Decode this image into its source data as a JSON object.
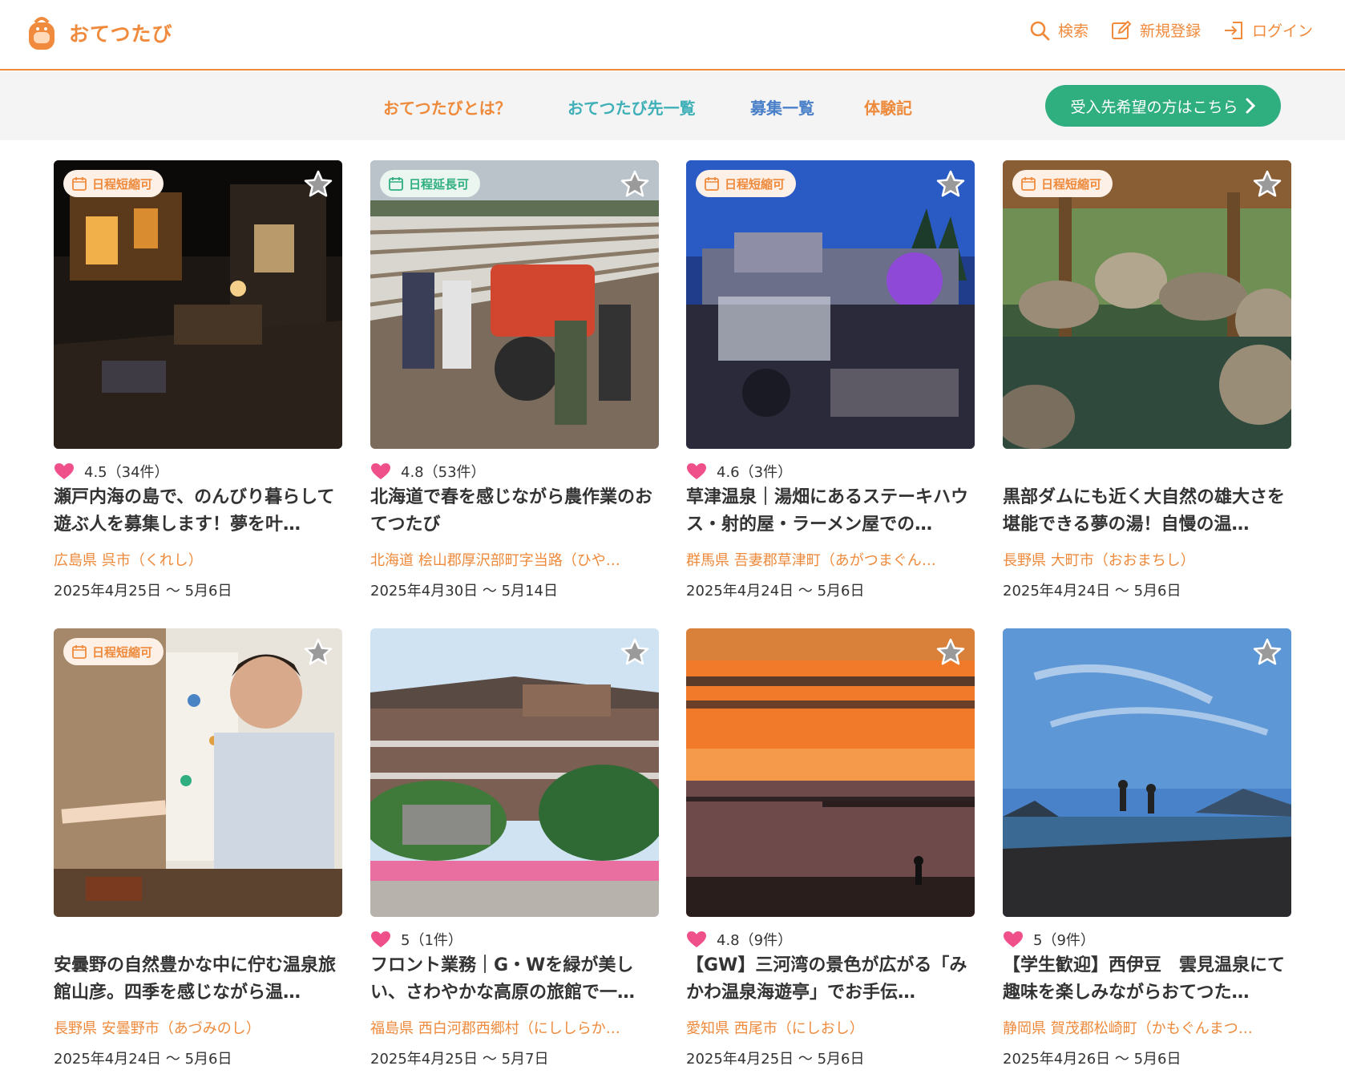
{
  "header": {
    "logo_text": "おてつたび",
    "search_label": "検索",
    "signup_label": "新規登録",
    "login_label": "ログイン"
  },
  "nav": {
    "about": "おてつたびとは？",
    "hosts": "おてつたび先一覧",
    "recruit": "募集一覧",
    "reports": "体験記",
    "cta": "受入先希望の方はこちら"
  },
  "colors": {
    "brand_orange": "#f08a3c",
    "teal": "#3fb0b8",
    "blue": "#4a80c8",
    "green": "#2fae80",
    "heart": "#f0508a"
  },
  "cards": [
    {
      "badge": "日程短縮可",
      "rating": "4.5（34件）",
      "title": "瀬戸内海の島で、のんびり暮らして遊ぶ人を募集します！夢を叶…",
      "location": "広島県 呉市（くれし）",
      "dates": "2025年4月25日 〜 5月6日"
    },
    {
      "badge": "日程延長可",
      "rating": "4.8（53件）",
      "title": "北海道で春を感じながら農作業のおてつたび",
      "location": "北海道 桧山郡厚沢部町字当路（ひや…",
      "dates": "2025年4月30日 〜 5月14日"
    },
    {
      "badge": "日程短縮可",
      "rating": "4.6（3件）",
      "title": "草津温泉｜湯畑にあるステーキハウス・射的屋・ラーメン屋での…",
      "location": "群馬県 吾妻郡草津町（あがつまぐん…",
      "dates": "2025年4月24日 〜 5月6日"
    },
    {
      "badge": "日程短縮可",
      "rating": "",
      "title": "黒部ダムにも近く大自然の雄大さを堪能できる夢の湯！自慢の温…",
      "location": "長野県 大町市（おおまちし）",
      "dates": "2025年4月24日 〜 5月6日"
    },
    {
      "badge": "日程短縮可",
      "rating": "",
      "title": "安曇野の自然豊かな中に佇む温泉旅館山彦。四季を感じながら温…",
      "location": "長野県 安曇野市（あづみのし）",
      "dates": "2025年4月24日 〜 5月6日"
    },
    {
      "badge": "",
      "rating": "5（1件）",
      "title": "フロント業務｜G・Wを緑が美しい、さわやかな高原の旅館で一…",
      "location": "福島県 西白河郡西郷村（にししらか…",
      "dates": "2025年4月25日 〜 5月7日"
    },
    {
      "badge": "",
      "rating": "4.8（9件）",
      "title": "【GW】三河湾の景色が広がる「みかわ温泉海遊亭」でお手伝…",
      "location": "愛知県 西尾市（にしおし）",
      "dates": "2025年4月25日 〜 5月6日"
    },
    {
      "badge": "",
      "rating": "5（9件）",
      "title": "【学生歓迎】西伊豆　雲見温泉にて趣味を楽しみながらおてつた…",
      "location": "静岡県 賀茂郡松崎町（かもぐんまつ…",
      "dates": "2025年4月26日 〜 5月6日"
    }
  ]
}
